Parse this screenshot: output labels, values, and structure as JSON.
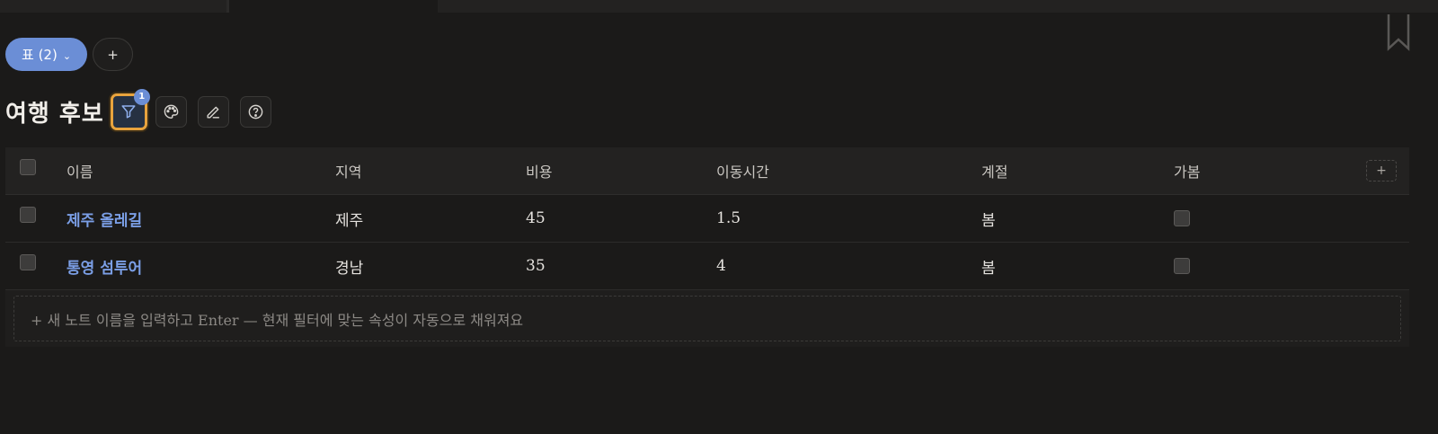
{
  "tabs": {
    "active_index": 1
  },
  "views": {
    "active_label": "표 (2)",
    "active_chevron": "⌄",
    "add_label": "+"
  },
  "page": {
    "title": "여행 후보"
  },
  "toolbar": {
    "filter_badge": "1",
    "icons": [
      "filter-icon",
      "palette-icon",
      "pencil-icon",
      "help-icon"
    ]
  },
  "table": {
    "columns": [
      "이름",
      "지역",
      "비용",
      "이동시간",
      "계절",
      "가봄"
    ],
    "add_column_label": "+",
    "rows": [
      {
        "name": "제주 올레길",
        "region": "제주",
        "cost": "45",
        "time": "1.5",
        "season": "봄",
        "went": false
      },
      {
        "name": "통영 섬투어",
        "region": "경남",
        "cost": "35",
        "time": "4",
        "season": "봄",
        "went": false
      }
    ],
    "new_note_placeholder": "+  새 노트 이름을 입력하고 Enter — 현재 필터에 맞는 속성이 자동으로 채워져요"
  },
  "colors": {
    "accent": "#6b8ed6",
    "focus_ring": "#e8a33d",
    "link": "#7b9fe6",
    "background": "#1b1a19"
  }
}
